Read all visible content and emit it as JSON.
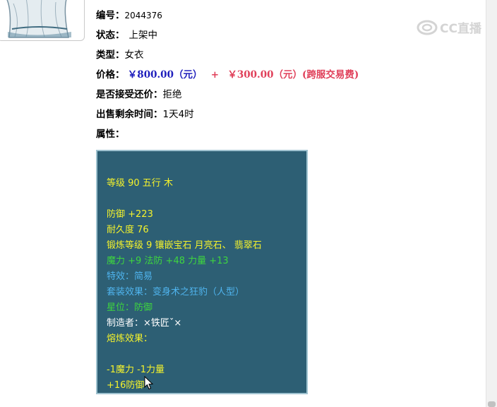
{
  "info": {
    "id_label": "编号：",
    "id_value": "2044376",
    "status_label": "状态：",
    "status_value": "上架中",
    "type_label": "类型：",
    "type_value": "女衣",
    "price_label": "价格：",
    "price_main": "￥800.00（元）",
    "price_plus": "+",
    "price_fee": "￥300.00（元）(跨服交易费)",
    "bargain_label": "是否接受还价：",
    "bargain_value": "拒绝",
    "remaining_label": "出售剩余时间：",
    "remaining_value": "1天4时",
    "attr_label": "属性："
  },
  "watermark": {
    "text": "CC直播",
    "icon": "cc-logo-icon"
  },
  "attributes": [
    {
      "text": "等级 90 五行 木",
      "color": "yellow"
    },
    {
      "text": "防御 +223",
      "color": "yellow"
    },
    {
      "text": "耐久度 76",
      "color": "yellow"
    },
    {
      "text": "锻炼等级 9 镶嵌宝石 月亮石、 翡翠石",
      "color": "yellow"
    },
    {
      "text": "魔力 +9 法防 +48 力量 +13",
      "color": "green"
    },
    {
      "text": "特效：简易",
      "color": "blue"
    },
    {
      "text": "套装效果：变身术之狂豹（人型）",
      "color": "blue"
    },
    {
      "text": "星位：防御",
      "color": "green"
    },
    {
      "text": "制造者：×铁匠ˇ×",
      "color": "white"
    },
    {
      "text": "熔炼效果：",
      "color": "yellow"
    },
    {
      "text": "-1魔力 -1力量",
      "color": "yellow"
    },
    {
      "text": "+16防御",
      "color": "yellow"
    }
  ],
  "colors": {
    "yellow": "#f4f22c",
    "green": "#3ed63e",
    "blue": "#4fb4ee",
    "white": "#ffffff",
    "panel_bg": "#2d5f74",
    "price_blue": "#1e1ebc",
    "price_red": "#e0405a"
  }
}
